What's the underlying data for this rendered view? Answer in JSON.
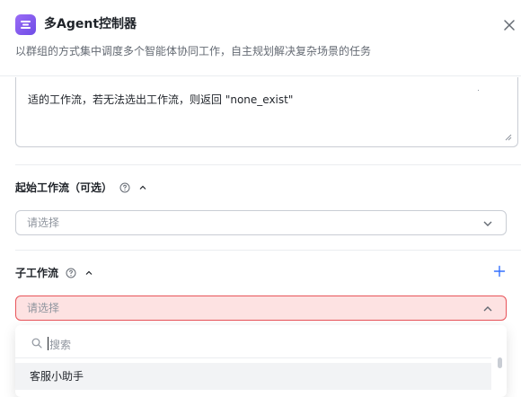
{
  "header": {
    "title": "多Agent控制器",
    "subtitle": "以群组的方式集中调度多个智能体协同工作，自主规划解决复杂场景的任务",
    "accent_color": "#7c5cf0"
  },
  "prompt_field": {
    "text": "适的工作流，若无法选出工作流，则返回 \"none_exist\""
  },
  "start_workflow": {
    "label": "起始工作流（可选）",
    "placeholder": "请选择"
  },
  "sub_workflow": {
    "label": "子工作流",
    "placeholder": "请选择",
    "error_color": "#e8545a"
  },
  "dropdown": {
    "search_placeholder": "搜索",
    "options": [
      "客服小助手"
    ]
  },
  "icons": {
    "close": "close-icon",
    "help": "question-circle-icon",
    "caret_up": "chevron-up-icon",
    "chevron_down": "chevron-down-icon",
    "add": "plus-icon",
    "search": "search-icon"
  }
}
